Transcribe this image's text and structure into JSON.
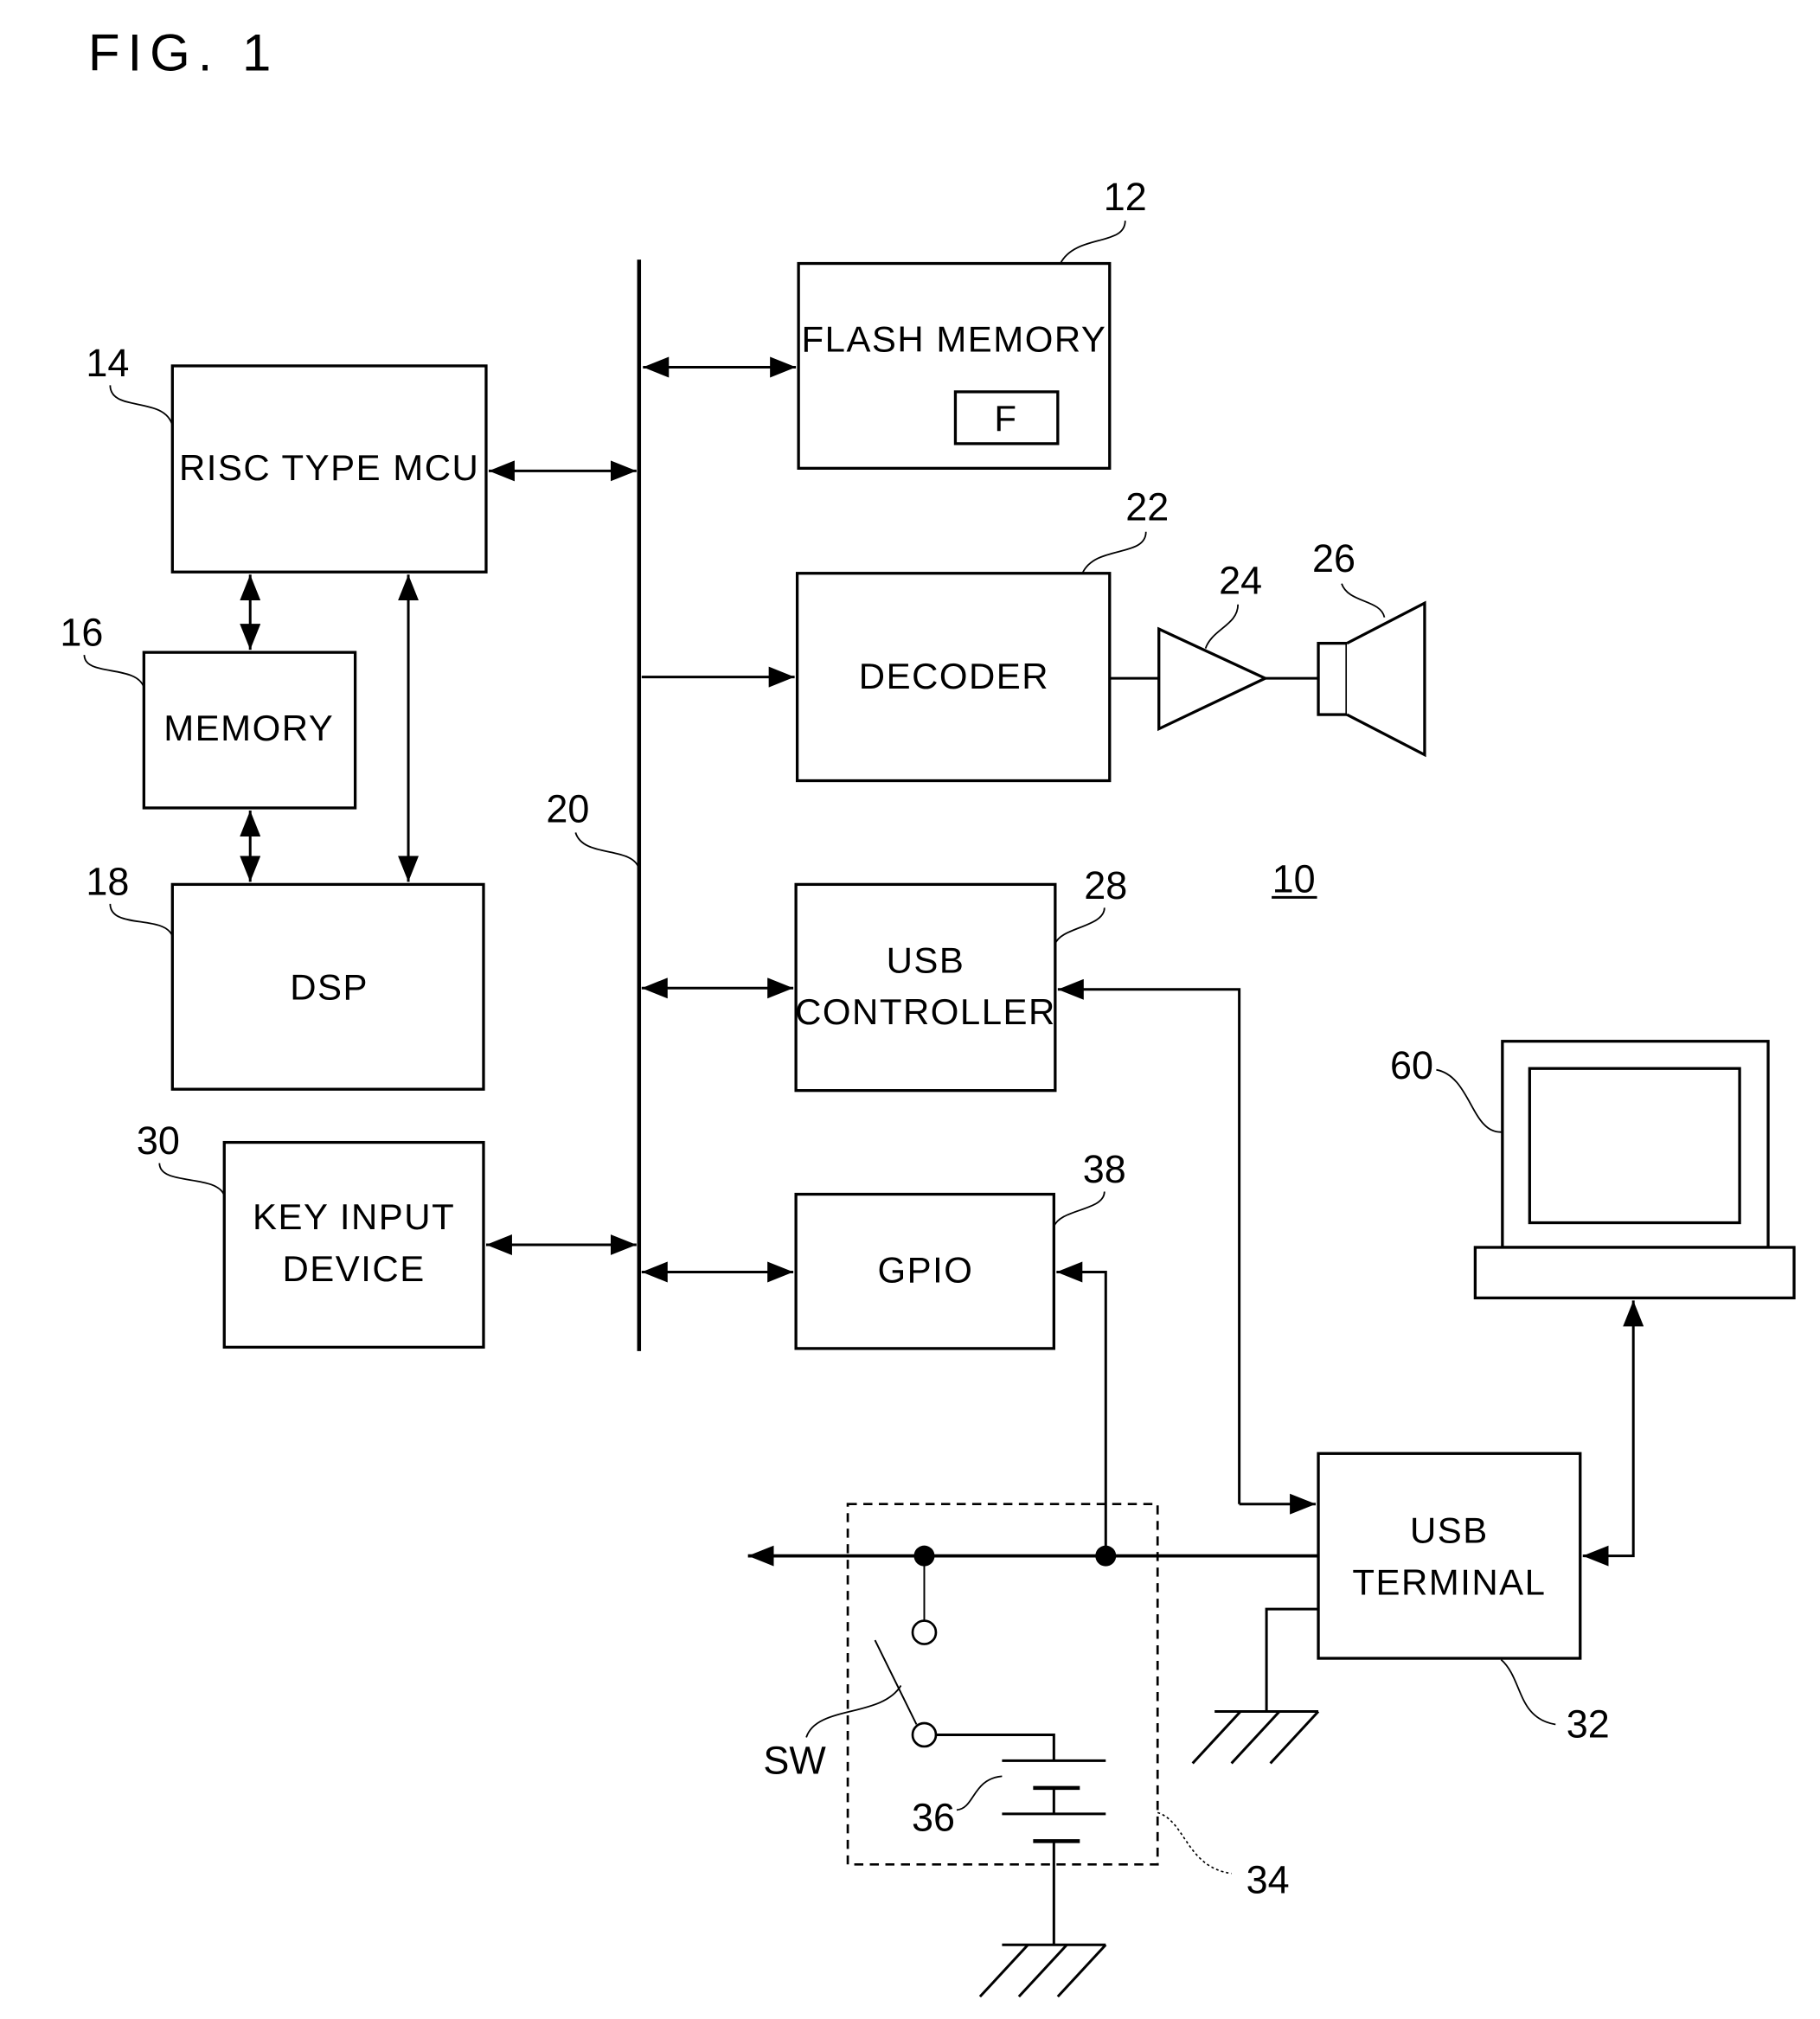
{
  "figure": {
    "title": "FIG. 1",
    "device_ref": "10"
  },
  "blocks": {
    "flash_memory": {
      "label": "FLASH MEMORY",
      "ref": "12",
      "inner_label": "F"
    },
    "risc_mcu": {
      "label": "RISC TYPE MCU",
      "ref": "14"
    },
    "memory": {
      "label": "MEMORY",
      "ref": "16"
    },
    "dsp": {
      "label": "DSP",
      "ref": "18"
    },
    "bus": {
      "ref": "20"
    },
    "decoder": {
      "label": "DECODER",
      "ref": "22"
    },
    "amplifier": {
      "ref": "24"
    },
    "speaker": {
      "ref": "26"
    },
    "usb_controller": {
      "label_line1": "USB",
      "label_line2": "CONTROLLER",
      "ref": "28"
    },
    "key_input": {
      "label_line1": "KEY INPUT",
      "label_line2": "DEVICE",
      "ref": "30"
    },
    "usb_terminal": {
      "label_line1": "USB",
      "label_line2": "TERMINAL",
      "ref": "32"
    },
    "power_circuit": {
      "ref": "34"
    },
    "battery": {
      "ref": "36"
    },
    "gpio": {
      "label": "GPIO",
      "ref": "38"
    },
    "switch": {
      "label": "SW"
    },
    "host_computer": {
      "ref": "60"
    }
  }
}
